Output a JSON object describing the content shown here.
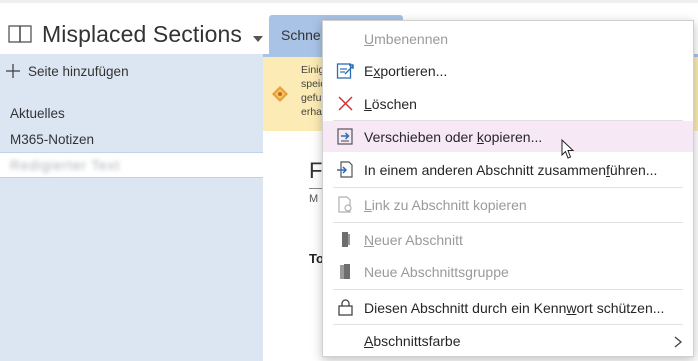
{
  "title_bar": {
    "notebook_name": "Misplaced Sections",
    "notebook_icon": "notebook-icon",
    "dropdown_icon": "chevron-down-icon"
  },
  "section_tab": {
    "label": "Schne"
  },
  "pages_pane": {
    "add_page_label": "Seite hinzufügen",
    "add_icon": "plus-icon",
    "items": [
      "Aktuelles",
      "M365-Notizen",
      "Redigierter Text"
    ],
    "selected_index": 2,
    "bg_color": "#dce6f3"
  },
  "info_bar": {
    "lines": [
      "Einig",
      "speic",
      "gefu",
      "erha"
    ],
    "icon": "warning-icon",
    "bg_color": "#fcebb4"
  },
  "content": {
    "title_fragment": "F",
    "meta_fragment": "M",
    "bold_fragment": "To"
  },
  "context_menu": {
    "items": [
      {
        "label_pre": "",
        "label_u": "U",
        "label_post": "mbenennen",
        "icon": "",
        "disabled": true
      },
      {
        "label_pre": "E",
        "label_u": "x",
        "label_post": "portieren...",
        "icon": "export-icon",
        "disabled": false
      },
      {
        "label_pre": "",
        "label_u": "L",
        "label_post": "öschen",
        "icon": "delete-x-icon",
        "disabled": false
      },
      {
        "label_pre": "Verschieben oder ",
        "label_u": "k",
        "label_post": "opieren...",
        "icon": "move-copy-icon",
        "disabled": false,
        "hovered": true
      },
      {
        "label_pre": "In einem anderen Abschnitt zusammen",
        "label_u": "f",
        "label_post": "ühren...",
        "icon": "merge-icon",
        "disabled": false
      },
      {
        "label_pre": "",
        "label_u": "L",
        "label_post": "ink zu Abschnitt kopieren",
        "icon": "link-icon",
        "disabled": true
      },
      {
        "label_pre": "",
        "label_u": "N",
        "label_post": "euer Abschnitt",
        "icon": "new-section-icon",
        "disabled": true
      },
      {
        "label_pre": "Neue Abschnitts",
        "label_u": "g",
        "label_post": "ruppe",
        "icon": "new-section-group-icon",
        "disabled": true
      },
      {
        "label_pre": "Diesen Abschnitt durch ein Kenn",
        "label_u": "w",
        "label_post": "ort schützen...",
        "icon": "lock-icon",
        "disabled": false
      },
      {
        "label_pre": "",
        "label_u": "A",
        "label_post": "bschnittsfarbe",
        "icon": "",
        "disabled": false,
        "submenu": true
      }
    ],
    "accent_color": "#2e6db4",
    "hover_color": "#f6e9f5",
    "delete_color": "#d13438"
  },
  "cursor": "mouse-pointer-icon"
}
